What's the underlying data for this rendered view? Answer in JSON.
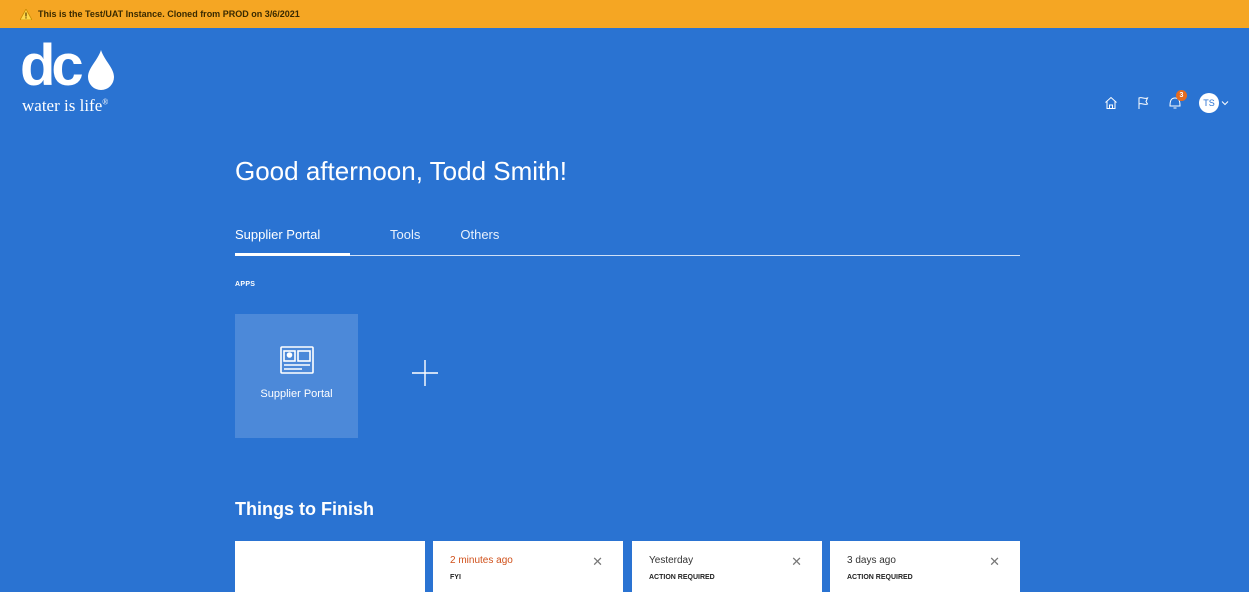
{
  "banner": {
    "text": "This is the Test/UAT Instance. Cloned from PROD on 3/6/2021"
  },
  "logo": {
    "text": "dc",
    "tagline": "water is life",
    "reg": "®"
  },
  "header": {
    "icons": [
      "home-icon",
      "flag-icon",
      "notifications-icon"
    ],
    "notification_count": "3",
    "user_initials": "TS"
  },
  "greeting": "Good afternoon, Todd Smith!",
  "tabs": [
    {
      "label": "Supplier Portal",
      "active": true
    },
    {
      "label": "Tools",
      "active": false
    },
    {
      "label": "Others",
      "active": false
    }
  ],
  "apps": {
    "section_label": "APPS",
    "tiles": [
      {
        "label": "Supplier Portal",
        "icon": "supplier-portal-icon"
      }
    ],
    "add_icon": "plus-icon"
  },
  "things_to_finish": {
    "title": "Things to Finish",
    "cards": [
      {
        "time": "",
        "kind": "",
        "partial_text": "...  ...  ..."
      },
      {
        "time": "2 minutes ago",
        "kind": "FYI",
        "highlight": true
      },
      {
        "time": "Yesterday",
        "kind": "ACTION REQUIRED",
        "highlight": false
      },
      {
        "time": "3 days ago",
        "kind": "ACTION REQUIRED",
        "highlight": false
      }
    ]
  },
  "colors": {
    "banner": "#f5a623",
    "background": "#2a73d2",
    "badge": "#e56b1f",
    "accent_time": "#d0501a"
  }
}
